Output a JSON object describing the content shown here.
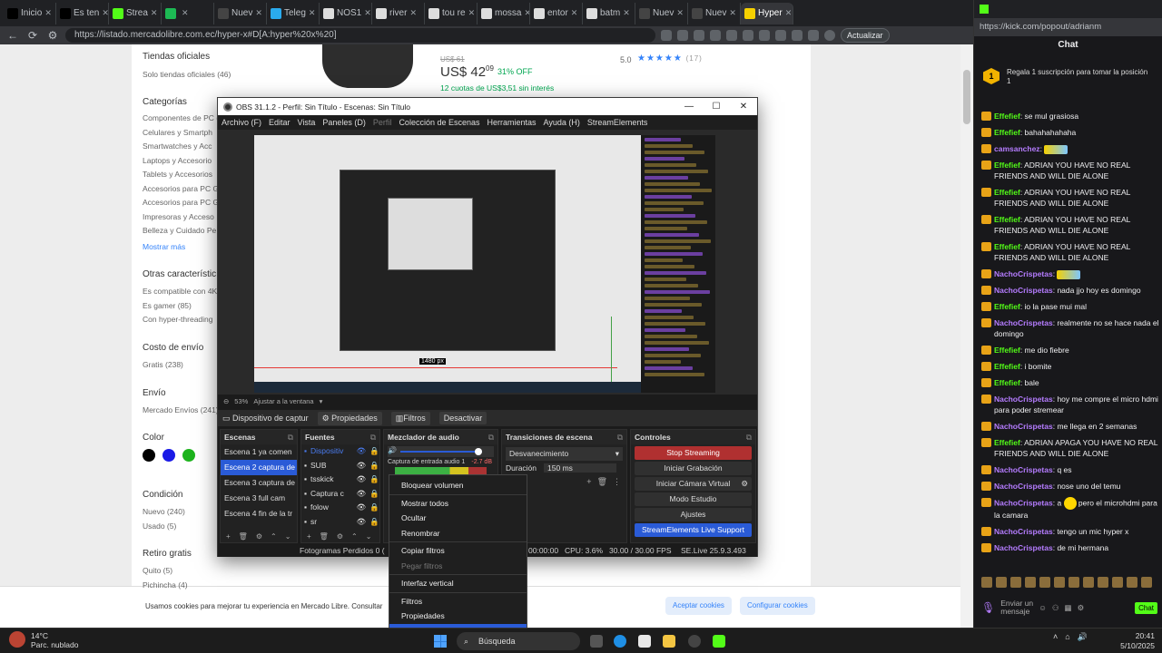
{
  "browser": {
    "tabs": [
      {
        "label": "Inicio",
        "color": "#000000"
      },
      {
        "label": "Es ten",
        "color": "#000000"
      },
      {
        "label": "Strea",
        "color": "#53fc18"
      },
      {
        "label": "",
        "color": "#1db954"
      },
      {
        "label": "Nuev",
        "color": "#444444"
      },
      {
        "label": "Teleg",
        "color": "#2aabee"
      },
      {
        "label": "NOS1",
        "color": "#dddddd"
      },
      {
        "label": "river",
        "color": "#dddddd"
      },
      {
        "label": "tou re",
        "color": "#dddddd"
      },
      {
        "label": "mossa",
        "color": "#dddddd"
      },
      {
        "label": "entor",
        "color": "#dddddd"
      },
      {
        "label": "batm",
        "color": "#dddddd"
      },
      {
        "label": "Nuev",
        "color": "#444444"
      },
      {
        "label": "Nuev",
        "color": "#444444"
      },
      {
        "label": "Hyper",
        "color": "#f5d000",
        "active": true
      }
    ],
    "url": "https://listado.mercadolibre.com.ec/hyper-x#D[A:hyper%20x%20]",
    "update_label": "Actualizar"
  },
  "page": {
    "filters": {
      "tiendas_title": "Tiendas oficiales",
      "tiendas_item": "Solo tiendas oficiales (46)",
      "categorias_title": "Categorías",
      "categorias": [
        "Componentes de PC (3",
        "Celulares y Smartph",
        "Smartwatches y Acc",
        "Laptops y Accesorio",
        "Tablets y Accesorios",
        "Accesorios para PC G",
        "Accesorios para PC G",
        "Impresoras y Acceso",
        "Belleza y Cuidado Pe"
      ],
      "mostrar_mas": "Mostrar más",
      "otras_title": "Otras característic",
      "otras": [
        "Es compatible con 4K",
        "Es gamer (85)",
        "Con hyper-threading"
      ],
      "costo_title": "Costo de envío",
      "costo_item": "Gratis (238)",
      "envio_title": "Envío",
      "envio_item": "Mercado Envíos (241)",
      "color_title": "Color",
      "condicion_title": "Condición",
      "condicion": [
        "Nuevo (240)",
        "Usado (5)"
      ],
      "retiro_title": "Retiro gratis",
      "retiro": [
        "Quito (5)",
        "Pichincha (4)"
      ]
    },
    "colors": [
      "#000000",
      "#1a1ae6",
      "#1db31d"
    ],
    "product": {
      "price_old": "US$ 61",
      "price": "US$ 42",
      "price_cents": "09",
      "discount": "31% OFF",
      "cuotas": "12 cuotas de US$3,51 sin interés",
      "rating": "5.0",
      "stars": "★★★★★",
      "reviews": "(17)"
    },
    "cookie": {
      "text": "Usamos cookies para mejorar tu experiencia en Mercado Libre. Consultar",
      "accept": "Aceptar cookies",
      "configure": "Configurar cookies"
    }
  },
  "obs": {
    "title": "OBS 31.1.2 - Perfil: Sin Título - Escenas: Sin Título",
    "menu": [
      "Archivo (F)",
      "Editar",
      "Vista",
      "Paneles (D)",
      "Perfil",
      "Colección de Escenas",
      "Herramientas",
      "Ayuda (H)",
      "StreamElements"
    ],
    "preview": {
      "px_label": "1480 px"
    },
    "zoom_label": "53%",
    "fit_label": "Ajustar a la ventana",
    "source_toolbar": {
      "device": "Dispositivo de captur",
      "props": "Propiedades",
      "filters": "Filtros",
      "deactivate": "Desactivar"
    },
    "scenes_title": "Escenas",
    "scenes": [
      "Escena 1 ya comen",
      "Escena 2 captura de",
      "Escena 3 captura de",
      "Escena 3 full cam",
      "Escena 4 fin de la tr"
    ],
    "sources_title": "Fuentes",
    "sources": [
      "Dispositiv",
      "SUB",
      "tsskick",
      "Captura c",
      "folow",
      "sr"
    ],
    "mixer_title": "Mezclador de audio",
    "mixer_channel": "Captura de entrada audio 1",
    "mixer_db": "-2.7 dB",
    "transitions_title": "Transiciones de escena",
    "transition": "Desvanecimiento",
    "duration_label": "Duración",
    "duration_value": "150 ms",
    "controls_title": "Controles",
    "controls": {
      "stop": "Stop Streaming",
      "record": "Iniciar Grabación",
      "vcam": "Iniciar Cámara Virtual",
      "studio": "Modo Estudio",
      "settings": "Ajustes",
      "se_support": "StreamElements Live Support"
    },
    "status": {
      "frames": "Fotogramas Perdidos 0 (",
      "time": "00:00:00",
      "cpu": "CPU: 3.6%",
      "fps": "30.00 / 30.00 FPS",
      "se": "SE.Live 25.9.3.493"
    }
  },
  "context_menu": {
    "items": [
      "Bloquear volumen",
      "Mostrar todos",
      "Ocultar",
      "Renombrar",
      "Copiar filtros",
      "Pegar filtros",
      "Interfaz vertical",
      "Filtros",
      "Propiedades",
      "Propiedades de audio avanzadas"
    ]
  },
  "chat": {
    "url": "https://kick.com/popout/adrianm",
    "title": "Chat",
    "gift_badge": "1",
    "gift_text": "Regala 1 suscripción para tomar la posición 1",
    "messages": [
      {
        "user": "Effefief",
        "text": ": se mul grasiosa",
        "color": "g"
      },
      {
        "user": "Effefief",
        "text": ": bahahahahaha",
        "color": "g"
      },
      {
        "user": "camsanchez",
        "text": ":",
        "color": "p",
        "emote": true
      },
      {
        "user": "Effefief",
        "text": ": ADRIAN YOU HAVE NO REAL FRIENDS AND WILL DIE ALONE",
        "color": "g"
      },
      {
        "user": "Effefief",
        "text": ": ADRIAN YOU HAVE NO REAL FRIENDS AND WILL DIE ALONE",
        "color": "g"
      },
      {
        "user": "Effefief",
        "text": ": ADRIAN YOU HAVE NO REAL FRIENDS AND WILL DIE ALONE",
        "color": "g"
      },
      {
        "user": "Effefief",
        "text": ": ADRIAN YOU HAVE NO REAL FRIENDS AND WILL DIE ALONE",
        "color": "g"
      },
      {
        "user": "NachoCrispetas",
        "text": ":",
        "color": "p",
        "emote": true
      },
      {
        "user": "NachoCrispetas",
        "text": ": nada jjo hoy es domingo",
        "color": "p"
      },
      {
        "user": "Effefief",
        "text": ": io la pase mui mal",
        "color": "g"
      },
      {
        "user": "NachoCrispetas",
        "text": ": realmente no se hace nada el domingo",
        "color": "p"
      },
      {
        "user": "Effefief",
        "text": ": me dio fiebre",
        "color": "g"
      },
      {
        "user": "Effefief",
        "text": ": i bomite",
        "color": "g"
      },
      {
        "user": "Effefief",
        "text": ": bale",
        "color": "g"
      },
      {
        "user": "NachoCrispetas",
        "text": ": hoy me compre el micro hdmi para poder stremear",
        "color": "p"
      },
      {
        "user": "NachoCrispetas",
        "text": ": me llega en 2 semanas",
        "color": "p"
      },
      {
        "user": "Effefief",
        "text": ": ADRIAN APAGA YOU HAVE NO REAL FRIENDS AND WILL DIE ALONE",
        "color": "g"
      },
      {
        "user": "NachoCrispetas",
        "text": ": q es",
        "color": "p"
      },
      {
        "user": "NachoCrispetas",
        "text": ": nose uno del temu",
        "color": "p"
      },
      {
        "user": "NachoCrispetas",
        "text": ": a",
        "text2": " pero el microhdmi para la camara",
        "color": "p",
        "smile": true
      },
      {
        "user": "NachoCrispetas",
        "text": ": tengo un mic hyper x",
        "color": "p"
      },
      {
        "user": "NachoCrispetas",
        "text": ": de mi hermana",
        "color": "p"
      }
    ],
    "input_placeholder": "Enviar un mensaje",
    "send_label": "Chat"
  },
  "taskbar": {
    "temp": "14°C",
    "weather": "Parc. nublado",
    "search": "Búsqueda",
    "time": "20:41",
    "date": "5/10/2025"
  }
}
